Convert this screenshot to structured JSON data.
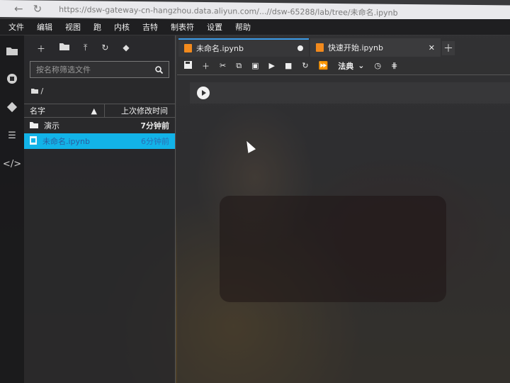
{
  "browser": {
    "url": "https://dsw-gateway-cn-hangzhou.data.aliyun.com/...//dsw-65288/lab/tree/未命名.ipynb"
  },
  "menu": [
    "文件",
    "编辑",
    "视图",
    "跑",
    "内核",
    "吉特",
    "制表符",
    "设置",
    "帮助"
  ],
  "file_browser": {
    "search_placeholder": "按名称筛选文件",
    "path": "/",
    "columns": {
      "name": "名字",
      "modified": "上次修改时间"
    },
    "items": [
      {
        "name": "演示",
        "modified": "7分钟前",
        "type": "folder",
        "selected": false
      },
      {
        "name": "未命名.ipynb",
        "modified": "6分钟前",
        "type": "notebook",
        "selected": true
      }
    ]
  },
  "tabs": [
    {
      "label": "未命名.ipynb",
      "active": true,
      "dirty": true
    },
    {
      "label": "快速开始.ipynb",
      "active": false,
      "dirty": false
    }
  ],
  "notebook_toolbar": {
    "kernel_select": "法典"
  }
}
